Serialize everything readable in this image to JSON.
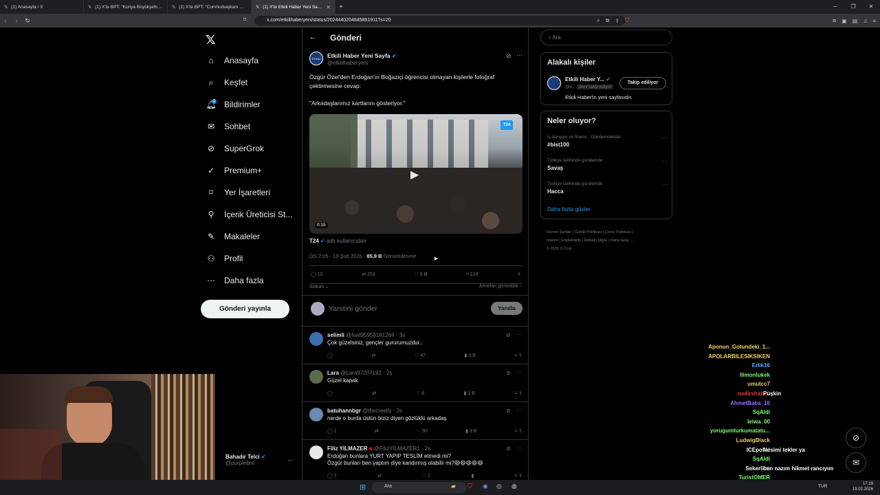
{
  "browser": {
    "tabs": [
      {
        "label": "(1) Anasayfa / X",
        "active": false
      },
      {
        "label": "(1) X'te BPT: \"Konya Büyükşehir Bele...",
        "active": false
      },
      {
        "label": "(1) X'te BPT: \"Cumhurbaşkanı Erdoğ...",
        "active": false
      },
      {
        "label": "(1) X'te Etkili Haber Yeni Sayfa: \"Ö...",
        "active": true
      }
    ],
    "url": "x.com/etkilihaberyeni/status/2024440204845891911?s=20"
  },
  "nav": {
    "items": [
      {
        "label": "Anasayfa",
        "icon": "home-icon"
      },
      {
        "label": "Keşfet",
        "icon": "search-icon"
      },
      {
        "label": "Bildirimler",
        "icon": "bell-icon",
        "badge": "1"
      },
      {
        "label": "Sohbet",
        "icon": "mail-icon"
      },
      {
        "label": "SuperGrok",
        "icon": "grok-icon"
      },
      {
        "label": "Premium+",
        "icon": "verified-icon"
      },
      {
        "label": "Yer İşaretleri",
        "icon": "bookmark-icon"
      },
      {
        "label": "İçerik Üreticisi St...",
        "icon": "creator-icon"
      },
      {
        "label": "Makaleler",
        "icon": "article-icon"
      },
      {
        "label": "Profil",
        "icon": "person-icon"
      },
      {
        "label": "Daha fazla",
        "icon": "more-circle-icon"
      }
    ],
    "post_button": "Gönderi yayınla",
    "account": {
      "name": "Bahadır Telci",
      "handle": "@purplebixi"
    }
  },
  "main": {
    "header": "Gönderi",
    "post": {
      "author": "Etkili Haber Yeni Sayfa",
      "handle": "@etkilihaberyeni",
      "text1": "Özgür Özel'den Erdoğan'ın Boğaziçi öğrencisi olmayan kişilerle fotoğraf çektirmesine cevap:",
      "text2": "\"Arkadaşlarımız kartlarını gösteriyor.\"",
      "video_duration": "0:15",
      "video_badge": "T24",
      "from_user": "T24",
      "from_suffix": "adlı kullanıcıdan",
      "time": "ÖS 2:05 · 19 Şub 2026 ·",
      "views": "85,9 B",
      "views_label": "Görüntülenme",
      "replies": "10",
      "reposts": "253",
      "likes": "5 B",
      "bookmarks": "124",
      "relevant": "Alakalı",
      "quotes": "Alıntıları görüntüle"
    },
    "composer": {
      "placeholder": "Yanıtını gönder",
      "button": "Yanıtla"
    },
    "replies": [
      {
        "name": "selimli",
        "handle": "@fuat95959181264 · 3s",
        "text": "Çok güzelsiniz, gençler gururumuzdur..",
        "likes": "47",
        "views": "3 B"
      },
      {
        "name": "Lara",
        "handle": "@Lara97207192 · 2s",
        "text": "Güzel kapak",
        "likes": "8",
        "views": "1 B"
      },
      {
        "name": "batuhannbgr",
        "handle": "@thecreells · 2s",
        "text": "nerde o burda üstün biziz diyen gözlüklü arkadaş",
        "likes": "90",
        "views": "3 B",
        "replies": "1"
      },
      {
        "name": "Filiz YILMAZER",
        "handle": "@FilizYILMAZER1 · 2s",
        "text": "Erdoğan bunlara YURT YAPIP TESLİM etmedi mi?",
        "text2": "Özgür bunları ben yaptım diye kandırmış olabilir mi?😄😄😄😄😄",
        "replies": "7",
        "likes": "2"
      }
    ]
  },
  "right": {
    "search_placeholder": "Ara",
    "related_title": "Alakalı kişiler",
    "related": {
      "name": "Etkili Haber Y...",
      "handle": "@e...",
      "follows_you": "Seni takip ediyor",
      "button": "Takip ediliyor",
      "bio": "Etkili Haber'in yeni sayfasıdır."
    },
    "trends_title": "Neler oluyor?",
    "trends": [
      {
        "context": "İş dünyası ve finans · Gündemdekiler",
        "name": "#bist100"
      },
      {
        "context": "Türkiye tarihinde gündemde",
        "name": "Savaş"
      },
      {
        "context": "Türkiye tarihinde gündemde",
        "name": "Hacca"
      }
    ],
    "show_more": "Daha fazla göster",
    "footer_line1": "Hizmet Şartları  |  Gizlilik Politikası  |  Çerez Politikası  |",
    "footer_line2": "Imprint  |  Erişilebilirlik  |  Reklam bilgisi  |  Daha fazla ···",
    "footer_line3": "© 2026 X Corp."
  },
  "stream_chat": [
    {
      "user": "Aponun_Gotundeki_1...",
      "msg": "",
      "color": "#f0d264"
    },
    {
      "user": "APOLARBILESIKSIKEN",
      "msg": "",
      "color": "#f0d264"
    },
    {
      "user": "Erlik16",
      "msg": "",
      "color": "#5aa9ff"
    },
    {
      "user": "llimonlukek",
      "msg": "",
      "color": "#7cfc6a"
    },
    {
      "user": "umutcc7",
      "msg": "",
      "color": "#f0d264"
    },
    {
      "user": "nadirshah26",
      "msg": "Puşkin",
      "color": "#e03c3c"
    },
    {
      "user": "AhmetBaba_16",
      "msg": "",
      "color": "#a070ff"
    },
    {
      "user": "SqAldi",
      "msg": "",
      "color": "#7cfc6a"
    },
    {
      "user": "leiwa_00",
      "msg": "",
      "color": "#7cfc6a"
    },
    {
      "user": "yorugumturkumatatu...",
      "msg": "",
      "color": "#7cfc6a"
    },
    {
      "user": "LudwigBlack",
      "msg": "",
      "color": "#f0d264"
    },
    {
      "user": "ICEpolisi",
      "msg": "Nesimi tekler ya",
      "color": "#ffffff"
    },
    {
      "user": "SqAldi",
      "msg": "",
      "color": "#7cfc6a"
    },
    {
      "user": "Sekerliim",
      "msg": "ben nazım hikmet rancıyım",
      "color": "#ffffff"
    },
    {
      "user": "TuristOMER",
      "msg": "",
      "color": "#7cfc6a"
    }
  ],
  "taskbar": {
    "search": "Ara",
    "lang": "TUR",
    "time": "17:19",
    "date": "19.02.2026"
  },
  "colors": {
    "accent": "#1d9bf0",
    "bg": "#000000",
    "border": "#2f3336"
  }
}
